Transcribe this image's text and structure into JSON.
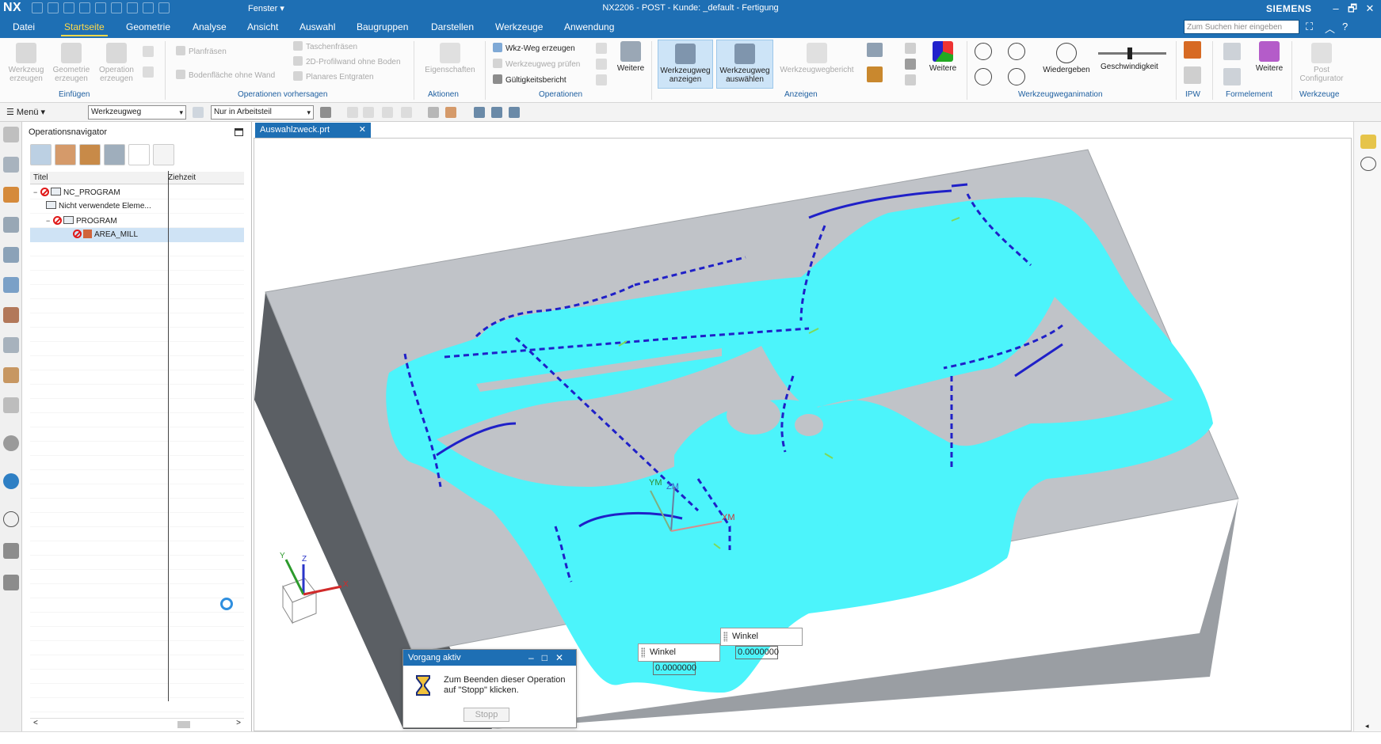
{
  "titlebar": {
    "logo": "NX",
    "window_menu": "Fenster ▾",
    "title": "NX2206 - POST - Kunde: _default - Fertigung",
    "brand": "SIEMENS",
    "minimize": "–",
    "restore": "🗗",
    "close": "✕"
  },
  "tabs": [
    "Datei",
    "Startseite",
    "Geometrie",
    "Analyse",
    "Ansicht",
    "Auswahl",
    "Baugruppen",
    "Darstellen",
    "Werkzeuge",
    "Anwendung"
  ],
  "active_tab": "Startseite",
  "search": {
    "placeholder": "Zum Suchen hier eingeben"
  },
  "ribbon": {
    "einfuegen": {
      "label": "Einfügen",
      "werkzeug": "Werkzeug erzeugen",
      "geometrie": "Geometrie erzeugen",
      "operation": "Operation erzeugen"
    },
    "vorhersagen": {
      "label": "Operationen vorhersagen",
      "planfraesen": "Planfräsen",
      "bodenflaeche": "Bodenfläche ohne Wand",
      "taschenfraesen": "Taschenfräsen",
      "profilwand": "2D-Profilwand ohne Boden",
      "entgraten": "Planares Entgraten"
    },
    "aktionen": {
      "label": "Aktionen",
      "eigenschaften": "Eigenschaften"
    },
    "operationen": {
      "label": "Operationen",
      "wkz_weg": "Wkz-Weg erzeugen",
      "pruefen": "Werkzeugweg prüfen",
      "gueltigkeit": "Gültigkeitsbericht",
      "weitere": "Weitere"
    },
    "anzeigen": {
      "label": "Anzeigen",
      "anzeigen_btn": "Werkzeugweg anzeigen",
      "auswaehlen_btn": "Werkzeugweg auswählen",
      "bericht": "Werkzeugwegbericht",
      "weitere": "Weitere"
    },
    "animation": {
      "label": "Werkzeugweganimation",
      "wiedergeben": "Wiedergeben",
      "geschwindigkeit": "Geschwindigkeit"
    },
    "ipw": {
      "label": "IPW"
    },
    "formelement": {
      "label": "Formelement",
      "weitere": "Weitere"
    },
    "werkzeuge": {
      "label": "Werkzeuge",
      "post": "Post Configurator"
    }
  },
  "toolbar": {
    "menu": "☰ Menü ▾",
    "filter": "Werkzeugweg",
    "scope": "Nur in Arbeitsteil"
  },
  "navigator": {
    "title": "Operationsnavigator",
    "col_title": "Titel",
    "col_time": "Ziehzeit",
    "rows": [
      {
        "label": "NC_PROGRAM",
        "expander": "−"
      },
      {
        "label": "Nicht verwendete Eleme...",
        "expander": ""
      },
      {
        "label": "PROGRAM",
        "expander": "−"
      },
      {
        "label": "AREA_MILL",
        "expander": ""
      }
    ],
    "scroll_left": "<",
    "scroll_right": ">"
  },
  "document_tab": {
    "label": "Auswahlzweck.prt",
    "close": "✕"
  },
  "viewport": {
    "triad_labels": {
      "ym": "YM",
      "zm": "ZM",
      "xm": "XM"
    },
    "wcs_labels": {
      "y": "Y",
      "z": "Z",
      "x": "X"
    },
    "winkel_label": "Winkel",
    "winkel_value_1": "0.0000000",
    "winkel_value_2": "0.0000000"
  },
  "dialog": {
    "title": "Vorgang aktiv",
    "message": "Zum Beenden dieser Operation auf \"Stopp\" klicken.",
    "button": "Stopp"
  },
  "colors": {
    "accent": "#1e6fb4",
    "active_tab": "#ffd94a",
    "pocket": "#4cf4fb",
    "block_top": "#c0c3c8",
    "toolpath": "#1f20c8"
  }
}
